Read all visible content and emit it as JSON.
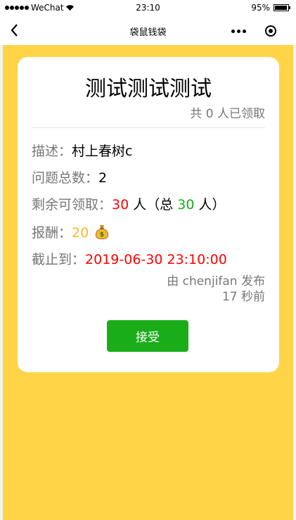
{
  "status_bar": {
    "carrier": "WeChat",
    "time": "23:10",
    "battery_text": "95%",
    "battery_level": 0.95
  },
  "nav": {
    "title": "袋鼠钱袋"
  },
  "card": {
    "title": "测试测试测试",
    "claimed_summary": "共 0 人已领取",
    "description": {
      "label": "描述：",
      "value": "村上春树c"
    },
    "question_count": {
      "label": "问题总数：",
      "value": "2"
    },
    "remaining": {
      "label": "剩余可领取：",
      "remaining_count": "30",
      "unit": " 人（总 ",
      "total_count": "30",
      "unit_close": " 人）"
    },
    "reward": {
      "label": "报酬：",
      "value": "20"
    },
    "deadline": {
      "label": "截止到：",
      "value": "2019-06-30 23:10:00"
    },
    "publisher_line": "由 chenjifan 发布",
    "time_ago": "17 秒前",
    "accept_label": "接受"
  },
  "colors": {
    "background": "#ffd447",
    "card": "#ffffff",
    "accent_green": "#1aad19",
    "accent_red": "#ff0000",
    "accent_gold": "#f5b82e",
    "label_gray": "#777777"
  },
  "icons": {
    "back": "chevron-left-icon",
    "more": "more-dots-icon",
    "close": "target-circle-icon",
    "reward": "money-bag-icon",
    "wifi": "wifi-icon",
    "battery": "battery-icon"
  }
}
